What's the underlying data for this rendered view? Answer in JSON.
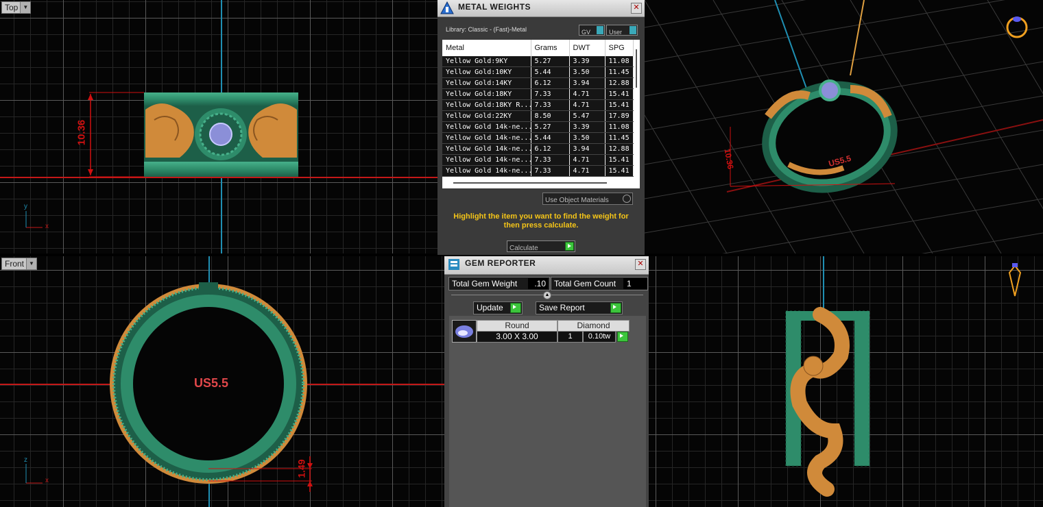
{
  "viewports": {
    "top": {
      "label": "Top",
      "dimension": "10.36",
      "axis_x": "x",
      "axis_y": "y"
    },
    "front": {
      "label": "Front",
      "ring_size": "US5.5",
      "dimension": "1.49",
      "axis_x": "x",
      "axis_z": "z"
    },
    "perspective": {
      "dimension": "10.36",
      "ring_size": "US5.5"
    }
  },
  "metal_weights": {
    "title": "METAL WEIGHTS",
    "library": "Library: Classic - (Fast)-Metal",
    "gv_label": "GV",
    "user_label": "User",
    "columns": [
      "Metal",
      "Grams",
      "DWT",
      "SPG"
    ],
    "rows": [
      [
        "Yellow Gold:9KY",
        "5.27",
        "3.39",
        "11.08"
      ],
      [
        "Yellow Gold:10KY",
        "5.44",
        "3.50",
        "11.45"
      ],
      [
        "Yellow Gold:14KY",
        "6.12",
        "3.94",
        "12.88"
      ],
      [
        "Yellow Gold:18KY",
        "7.33",
        "4.71",
        "15.41"
      ],
      [
        "Yellow Gold:18KY R...",
        "7.33",
        "4.71",
        "15.41"
      ],
      [
        "Yellow Gold:22KY",
        "8.50",
        "5.47",
        "17.89"
      ],
      [
        "Yellow Gold 14k-ne...",
        "5.27",
        "3.39",
        "11.08"
      ],
      [
        "Yellow Gold 14k-ne...",
        "5.44",
        "3.50",
        "11.45"
      ],
      [
        "Yellow Gold 14k-ne...",
        "6.12",
        "3.94",
        "12.88"
      ],
      [
        "Yellow Gold 14k-ne...",
        "7.33",
        "4.71",
        "15.41"
      ],
      [
        "Yellow Gold 14k-ne...",
        "7.33",
        "4.71",
        "15.41"
      ]
    ],
    "use_object_materials": "Use Object Materials",
    "hint": "Highlight the item you want to find the weight for then press calculate.",
    "calculate_label": "Calculate"
  },
  "gem_reporter": {
    "title": "GEM REPORTER",
    "total_weight_label": "Total Gem Weight",
    "total_weight_value": ".10",
    "total_count_label": "Total Gem Count",
    "total_count_value": "1",
    "update_label": "Update",
    "save_report_label": "Save Report",
    "table_headers": [
      "Round",
      "Diamond"
    ],
    "gem": {
      "size": "3.00 X 3.00",
      "count": "1",
      "weight": "0.10tw"
    }
  },
  "colors": {
    "green_metal": "#2e8c6a",
    "gold_metal": "#d08a3a",
    "axis_red": "#c41818",
    "axis_blue": "#1f8fb3",
    "hint_yellow": "#f5c518"
  }
}
